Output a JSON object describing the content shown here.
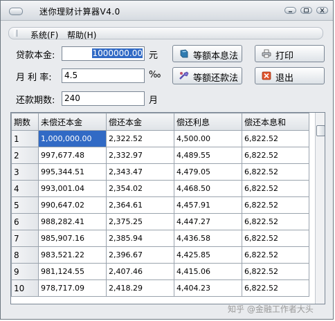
{
  "window": {
    "title": "迷你理财计算器V4.0"
  },
  "menu": {
    "system": "系统(F)",
    "help": "帮助(H)"
  },
  "form": {
    "principal_label": "贷款本金:",
    "principal_value": "1000000.00",
    "principal_unit": "元",
    "rate_label": "月 利 率:",
    "rate_value": "4.5",
    "rate_unit": "‰",
    "periods_label": "还款期数:",
    "periods_value": "240",
    "periods_unit": "月"
  },
  "buttons": {
    "equal_payment": "等额本息法",
    "equal_principal": "等额还款法",
    "print": "打印",
    "exit": "退出"
  },
  "table": {
    "columns": [
      "期数",
      "未偿还本金",
      "偿还本金",
      "偿还利息",
      "偿还本息和"
    ],
    "rows": [
      [
        "1",
        "1,000,000.00",
        "2,322.52",
        "4,500.00",
        "6,822.52"
      ],
      [
        "2",
        "997,677.48",
        "2,332.97",
        "4,489.55",
        "6,822.52"
      ],
      [
        "3",
        "995,344.51",
        "2,343.47",
        "4,479.05",
        "6,822.52"
      ],
      [
        "4",
        "993,001.04",
        "2,354.02",
        "4,468.50",
        "6,822.52"
      ],
      [
        "5",
        "990,647.02",
        "2,364.61",
        "4,457.91",
        "6,822.52"
      ],
      [
        "6",
        "988,282.41",
        "2,375.25",
        "4,447.27",
        "6,822.52"
      ],
      [
        "7",
        "985,907.16",
        "2,385.94",
        "4,436.58",
        "6,822.52"
      ],
      [
        "8",
        "983,521.22",
        "2,396.67",
        "4,425.85",
        "6,822.52"
      ],
      [
        "9",
        "981,124.55",
        "2,407.46",
        "4,415.06",
        "6,822.52"
      ],
      [
        "10",
        "978,717.09",
        "2,418.29",
        "4,404.23",
        "6,822.52"
      ]
    ]
  },
  "watermark": "知乎 @金融工作者大头"
}
